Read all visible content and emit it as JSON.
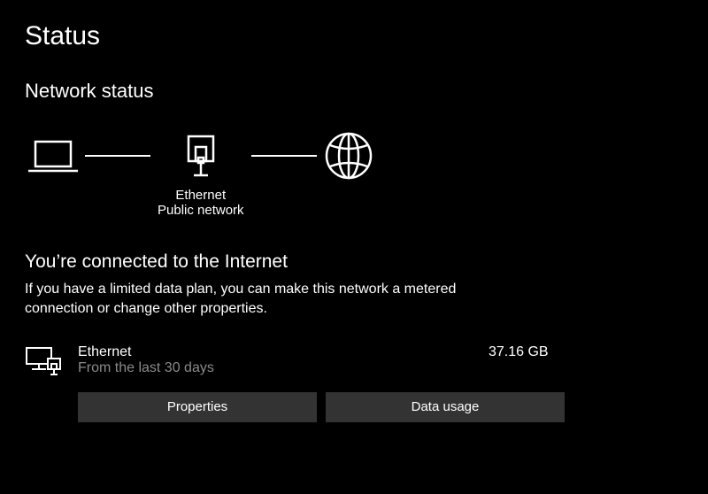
{
  "page": {
    "title": "Status",
    "section_title": "Network status"
  },
  "topology": {
    "adapter_label": "Ethernet",
    "network_type": "Public network"
  },
  "connection": {
    "heading": "You’re connected to the Internet",
    "description": "If you have a limited data plan, you can make this network a metered connection or change other properties."
  },
  "adapter": {
    "name": "Ethernet",
    "period": "From the last 30 days",
    "usage": "37.16 GB"
  },
  "buttons": {
    "properties": "Properties",
    "data_usage": "Data usage"
  }
}
